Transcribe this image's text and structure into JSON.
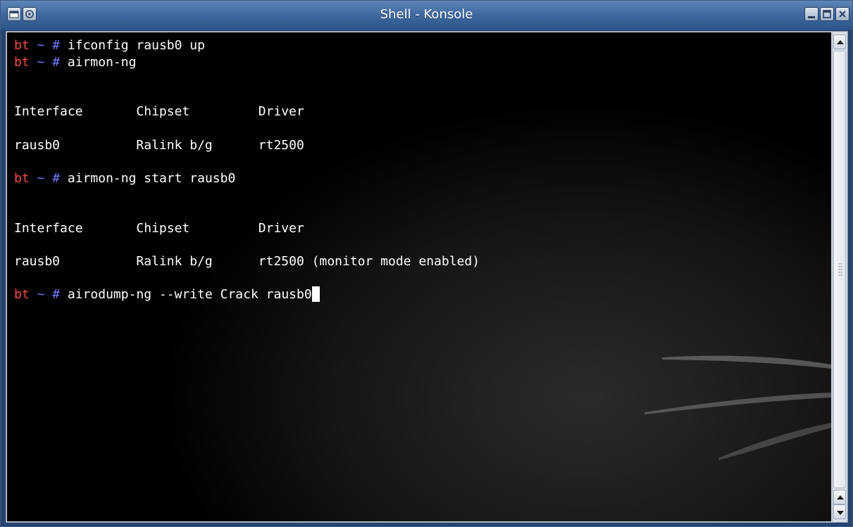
{
  "window": {
    "title": "Shell - Konsole"
  },
  "titlebar": {
    "icons": {
      "menu": "window-menu-icon",
      "sticky": "sticky-icon",
      "minimize": "minimize-icon",
      "maximize": "maximize-icon",
      "close": "close-icon"
    }
  },
  "terminal": {
    "lines": [
      {
        "type": "prompt",
        "host": "bt",
        "tilde": "~",
        "hash": "#",
        "cmd": " ifconfig rausb0 up"
      },
      {
        "type": "prompt",
        "host": "bt",
        "tilde": "~",
        "hash": "#",
        "cmd": " airmon-ng"
      },
      {
        "type": "text",
        "text": ""
      },
      {
        "type": "text",
        "text": ""
      },
      {
        "type": "text",
        "text": "Interface       Chipset         Driver"
      },
      {
        "type": "text",
        "text": ""
      },
      {
        "type": "text",
        "text": "rausb0          Ralink b/g      rt2500"
      },
      {
        "type": "text",
        "text": ""
      },
      {
        "type": "prompt",
        "host": "bt",
        "tilde": "~",
        "hash": "#",
        "cmd": " airmon-ng start rausb0"
      },
      {
        "type": "text",
        "text": ""
      },
      {
        "type": "text",
        "text": ""
      },
      {
        "type": "text",
        "text": "Interface       Chipset         Driver"
      },
      {
        "type": "text",
        "text": ""
      },
      {
        "type": "text",
        "text": "rausb0          Ralink b/g      rt2500 (monitor mode enabled)"
      },
      {
        "type": "text",
        "text": ""
      },
      {
        "type": "prompt",
        "host": "bt",
        "tilde": "~",
        "hash": "#",
        "cmd": " airodump-ng --write Crack rausb0",
        "cursor": true
      }
    ],
    "colors": {
      "host": "#ff4747",
      "prompt_symbols": "#6f78ff",
      "text": "#ffffff",
      "background": "#000000"
    }
  },
  "scrollbar": {
    "icons": {
      "up_top": "scroll-up-arrow-icon",
      "up_bottom": "scroll-up-arrow-icon",
      "down": "scroll-down-arrow-icon"
    }
  }
}
